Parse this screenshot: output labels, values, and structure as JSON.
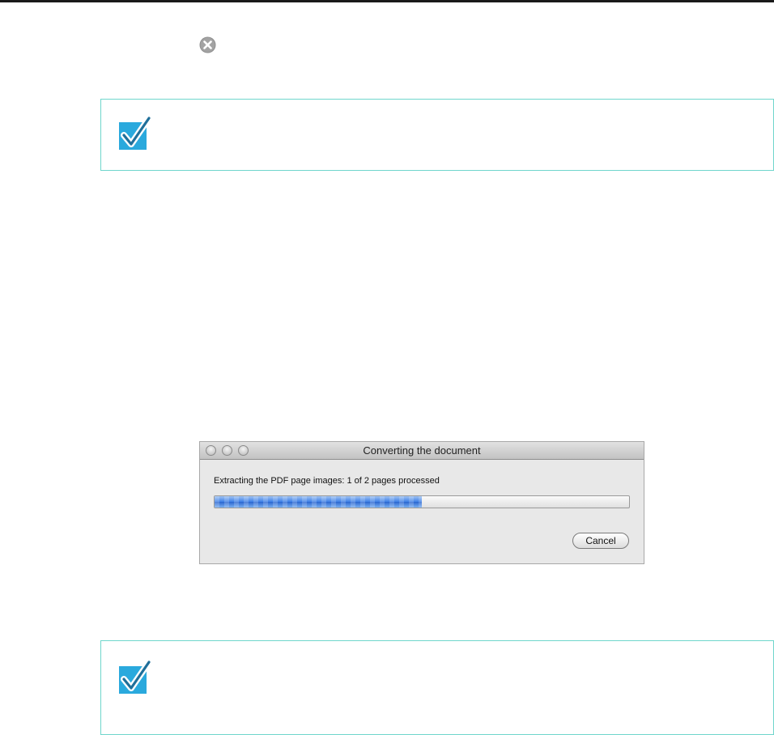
{
  "icons": {
    "close": "close-circle-icon",
    "note": "checkmark-icon"
  },
  "colors": {
    "note_border": "#6fd6cc",
    "note_icon": "#2aa9dd",
    "progress_fill": "#3d7fe6"
  },
  "dialog": {
    "title": "Converting the document",
    "status": "Extracting the PDF page images: 1 of 2 pages processed",
    "progress_fraction": 0.5,
    "cancel_label": "Cancel"
  }
}
